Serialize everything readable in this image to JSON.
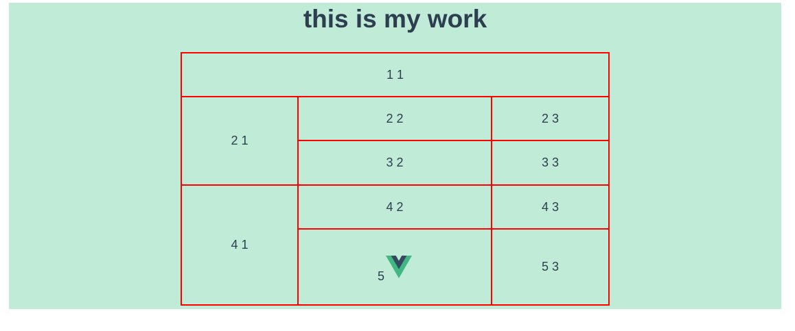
{
  "page": {
    "title": "this is my work"
  },
  "table": {
    "r1c1": "1 1",
    "r2c1": "2 1",
    "r2c2": "2 2",
    "r2c3": "2 3",
    "r3c2": "3 2",
    "r3c3": "3 3",
    "r4c1": "4 1",
    "r4c2": "4 2",
    "r4c3": "4 3",
    "r5c2": "5",
    "r5c3": "5 3"
  },
  "colors": {
    "background": "#c0ebd7",
    "border": "#ff0000",
    "text": "#2c3e50",
    "logo_green": "#41b883",
    "logo_dark": "#34495e"
  },
  "icons": {
    "logo": "vue-logo-icon"
  }
}
